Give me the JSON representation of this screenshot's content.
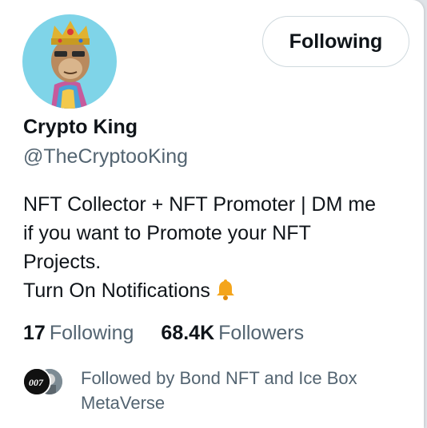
{
  "profile": {
    "name": "Crypto King",
    "handle": "@TheCryptooKing",
    "follow_button_label": "Following",
    "bio_lines": [
      "NFT Collector + NFT Promoter | DM me",
      "if you want to Promote your NFT",
      "Projects.",
      "Turn On Notifications"
    ],
    "bio_emoji": "bell-icon"
  },
  "stats": {
    "following_count": "17",
    "following_label": "Following",
    "followers_count": "68.4K",
    "followers_label": "Followers"
  },
  "mutuals": {
    "text": "Followed by Bond NFT and Ice Box MetaVerse",
    "avatar1_text": "007"
  },
  "colors": {
    "primary_text": "#0f1419",
    "secondary_text": "#536471",
    "border": "#cfd9de",
    "bell": "#f4a51c",
    "avatar_bg": "#7fd4e8"
  }
}
